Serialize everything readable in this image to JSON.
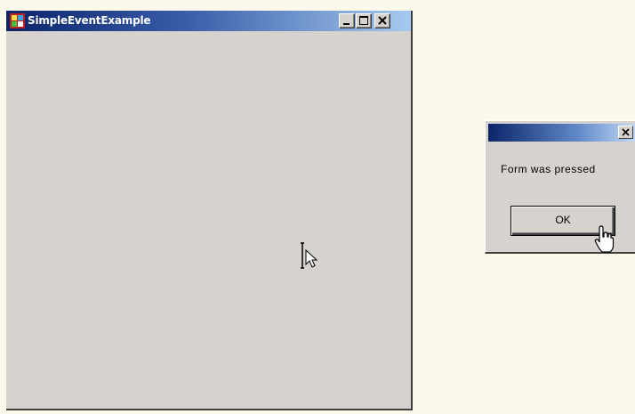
{
  "main_window": {
    "title": "SimpleEventExample",
    "icons": {
      "app": "app-icon",
      "minimize": "minimize-icon",
      "maximize": "maximize-icon",
      "close": "close-icon",
      "cursor": "ibeam-cursor-icon"
    }
  },
  "dialog": {
    "title": "",
    "message": "Form was pressed",
    "ok_label": "OK",
    "icons": {
      "close": "close-icon",
      "cursor": "hand-cursor-icon"
    }
  },
  "colors": {
    "background": "#fdf8ec",
    "window_face": "#d6d3ce",
    "title_bar_start": "#0b246a",
    "title_bar_end": "#a6caf0"
  }
}
